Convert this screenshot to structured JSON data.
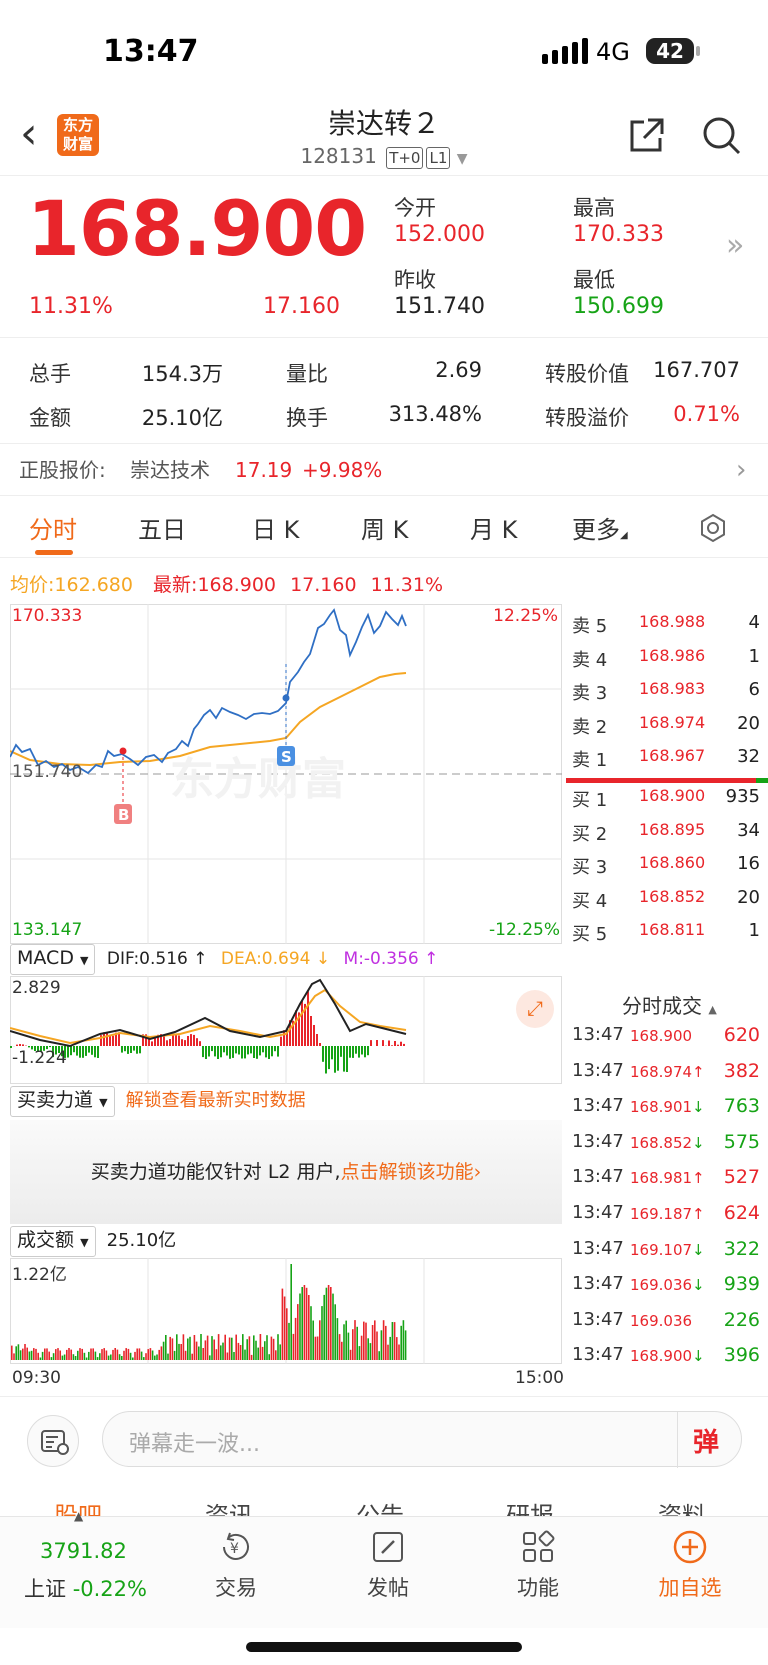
{
  "status": {
    "time": "13:47",
    "network": "4G",
    "battery": "42"
  },
  "header": {
    "title": "崇达转２",
    "code": "128131",
    "tags": [
      "T+0",
      "L1"
    ],
    "logo": "东方财富"
  },
  "quote": {
    "price": "168.900",
    "change_pct": "11.31%",
    "change": "17.160",
    "open_label": "今开",
    "open": "152.000",
    "high_label": "最高",
    "high": "170.333",
    "prev_label": "昨收",
    "prev": "151.740",
    "low_label": "最低",
    "low": "150.699"
  },
  "stats": {
    "vol_label": "总手",
    "vol": "154.3万",
    "ratio_label": "量比",
    "ratio": "2.69",
    "conv_val_label": "转股价值",
    "conv_val": "167.707",
    "amount_label": "金额",
    "amount": "25.10亿",
    "turnover_label": "换手",
    "turnover": "313.48%",
    "premium_label": "转股溢价",
    "premium": "0.71%"
  },
  "underlying": {
    "label": "正股报价:",
    "name": "崇达技术",
    "price": "17.19",
    "pct": "+9.98%"
  },
  "tabs": [
    "分时",
    "五日",
    "日 K",
    "周 K",
    "月 K",
    "更多"
  ],
  "avgline": {
    "avg_label": "均价:",
    "avg": "162.680",
    "latest_label": "最新:",
    "latest": "168.900",
    "chg": "17.160",
    "pct": "11.31%"
  },
  "chart_labels": {
    "top": "170.333",
    "prev": "151.740",
    "bottom": "133.147",
    "top_pct": "12.25%",
    "bottom_pct": "-12.25%",
    "buy_marker": "B",
    "sell_marker": "S",
    "watermark": "东方财富"
  },
  "orderbook": [
    {
      "name": "卖 5",
      "price": "168.988",
      "qty": "4"
    },
    {
      "name": "卖 4",
      "price": "168.986",
      "qty": "1"
    },
    {
      "name": "卖 3",
      "price": "168.983",
      "qty": "6"
    },
    {
      "name": "卖 2",
      "price": "168.974",
      "qty": "20"
    },
    {
      "name": "卖 1",
      "price": "168.967",
      "qty": "32"
    },
    {
      "name": "买 1",
      "price": "168.900",
      "qty": "935"
    },
    {
      "name": "买 2",
      "price": "168.895",
      "qty": "34"
    },
    {
      "name": "买 3",
      "price": "168.860",
      "qty": "16"
    },
    {
      "name": "买 4",
      "price": "168.852",
      "qty": "20"
    },
    {
      "name": "买 5",
      "price": "168.811",
      "qty": "1"
    }
  ],
  "macd": {
    "select": "MACD",
    "dif": "DIF:0.516 ↑",
    "dea": "DEA:0.694 ↓",
    "m": "M:-0.356 ↑",
    "top": "2.829",
    "bottom": "-1.224"
  },
  "flow": {
    "select": "买卖力道",
    "unlock": "解锁查看最新实时数据",
    "msg": "买卖力道功能仅针对 L2 用户,",
    "link": "点击解锁该功能"
  },
  "volume": {
    "select": "成交额",
    "total": "25.10亿",
    "max": "1.22亿",
    "start": "09:30",
    "end": "15:00"
  },
  "trades_title": "分时成交",
  "trades": [
    {
      "time": "13:47",
      "price": "168.900",
      "arrow": "",
      "qty": "620",
      "dir": "up"
    },
    {
      "time": "13:47",
      "price": "168.974",
      "arrow": "↑",
      "qty": "382",
      "dir": "up"
    },
    {
      "time": "13:47",
      "price": "168.901",
      "arrow": "↓",
      "qty": "763",
      "dir": "down"
    },
    {
      "time": "13:47",
      "price": "168.852",
      "arrow": "↓",
      "qty": "575",
      "dir": "down"
    },
    {
      "time": "13:47",
      "price": "168.981",
      "arrow": "↑",
      "qty": "527",
      "dir": "up"
    },
    {
      "time": "13:47",
      "price": "169.187",
      "arrow": "↑",
      "qty": "624",
      "dir": "up"
    },
    {
      "time": "13:47",
      "price": "169.107",
      "arrow": "↓",
      "qty": "322",
      "dir": "down"
    },
    {
      "time": "13:47",
      "price": "169.036",
      "arrow": "↓",
      "qty": "939",
      "dir": "down"
    },
    {
      "time": "13:47",
      "price": "169.036",
      "arrow": "",
      "qty": "226",
      "dir": "down"
    },
    {
      "time": "13:47",
      "price": "168.900",
      "arrow": "↓",
      "qty": "396",
      "dir": "down"
    }
  ],
  "danmu": {
    "placeholder": "弹幕走一波...",
    "btn": "弹"
  },
  "navtabs": [
    "股吧",
    "资讯",
    "公告",
    "研报",
    "资料"
  ],
  "bottom": {
    "index_value": "3791.82",
    "index_name": "上证",
    "index_pct": "-0.22%",
    "trade": "交易",
    "post": "发帖",
    "func": "功能",
    "add": "加自选"
  },
  "colors": {
    "up": "#e8252b",
    "down": "#16a316",
    "accent": "#f06a1a",
    "price_line": "#2f6fc4",
    "avg_line": "#f5a623"
  }
}
